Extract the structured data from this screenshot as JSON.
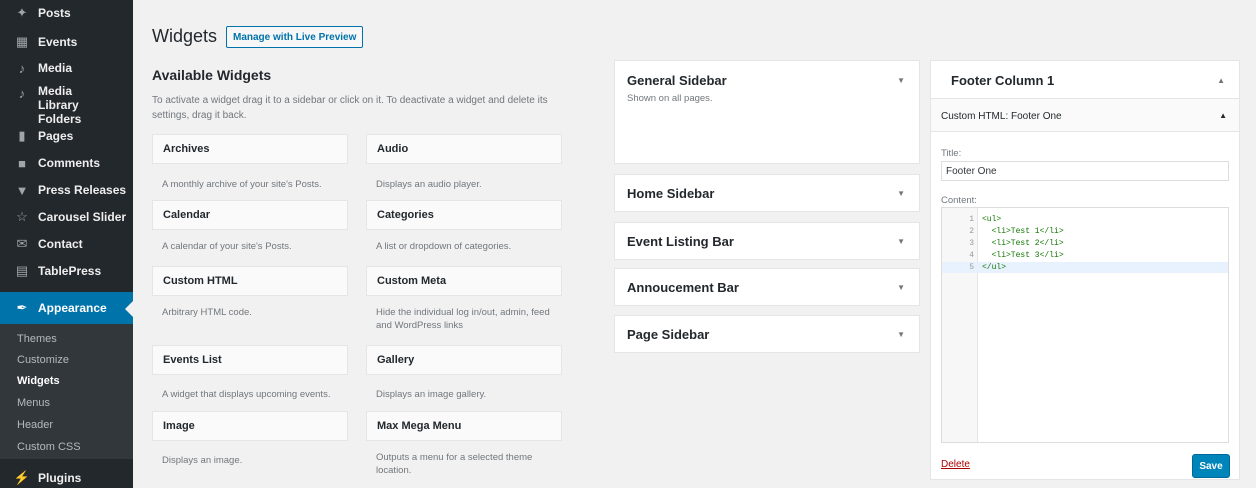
{
  "sidebar": {
    "items": [
      {
        "label": "Posts",
        "icon": "pin-icon"
      },
      {
        "label": "Events",
        "icon": "calendar-icon"
      },
      {
        "label": "Media",
        "icon": "media-icon"
      },
      {
        "label": "Media Library Folders",
        "icon": "media-icon"
      },
      {
        "label": "Pages",
        "icon": "page-icon"
      },
      {
        "label": "Comments",
        "icon": "comment-icon"
      },
      {
        "label": "Press Releases",
        "icon": "megaphone-icon"
      },
      {
        "label": "Carousel Slider",
        "icon": "slider-icon"
      },
      {
        "label": "Contact",
        "icon": "mail-icon"
      },
      {
        "label": "TablePress",
        "icon": "table-icon"
      },
      {
        "label": "Appearance",
        "icon": "brush-icon"
      },
      {
        "label": "Plugins",
        "icon": "plugin-icon"
      }
    ],
    "submenu": [
      "Themes",
      "Customize",
      "Widgets",
      "Menus",
      "Header",
      "Custom CSS"
    ]
  },
  "header": {
    "title": "Widgets",
    "live_preview_label": "Manage with Live Preview"
  },
  "available": {
    "title": "Available Widgets",
    "description": "To activate a widget drag it to a sidebar or click on it. To deactivate a widget and delete its settings, drag it back.",
    "widgets": [
      {
        "name": "Archives",
        "desc": "A monthly archive of your site's Posts."
      },
      {
        "name": "Audio",
        "desc": "Displays an audio player."
      },
      {
        "name": "Calendar",
        "desc": "A calendar of your site's Posts."
      },
      {
        "name": "Categories",
        "desc": "A list or dropdown of categories."
      },
      {
        "name": "Custom HTML",
        "desc": "Arbitrary HTML code."
      },
      {
        "name": "Custom Meta",
        "desc": "Hide the individual log in/out, admin, feed and WordPress links"
      },
      {
        "name": "Events List",
        "desc": "A widget that displays upcoming events."
      },
      {
        "name": "Gallery",
        "desc": "Displays an image gallery."
      },
      {
        "name": "Image",
        "desc": "Displays an image."
      },
      {
        "name": "Max Mega Menu",
        "desc": "Outputs a menu for a selected theme location."
      }
    ]
  },
  "sidebars": [
    {
      "name": "General Sidebar",
      "desc": "Shown on all pages."
    },
    {
      "name": "Home Sidebar"
    },
    {
      "name": "Event Listing Bar"
    },
    {
      "name": "Annoucement Bar"
    },
    {
      "name": "Page Sidebar"
    }
  ],
  "footer": {
    "title": "Footer Column 1",
    "widget_title": "Custom HTML: Footer One",
    "title_label": "Title:",
    "title_value": "Footer One",
    "content_label": "Content:",
    "code_lines": [
      {
        "n": "1",
        "code": "<ul>"
      },
      {
        "n": "2",
        "code": "  <li>Test 1</li>"
      },
      {
        "n": "3",
        "code": "  <li>Test 2</li>"
      },
      {
        "n": "4",
        "code": "  <li>Test 3</li>"
      },
      {
        "n": "5",
        "code": "</ul>"
      }
    ],
    "delete_label": "Delete",
    "save_label": "Save"
  },
  "colors": {
    "sidebar_bg": "#23282d",
    "accent": "#0073aa",
    "save_button": "#0085ba",
    "delete": "#a00000"
  }
}
